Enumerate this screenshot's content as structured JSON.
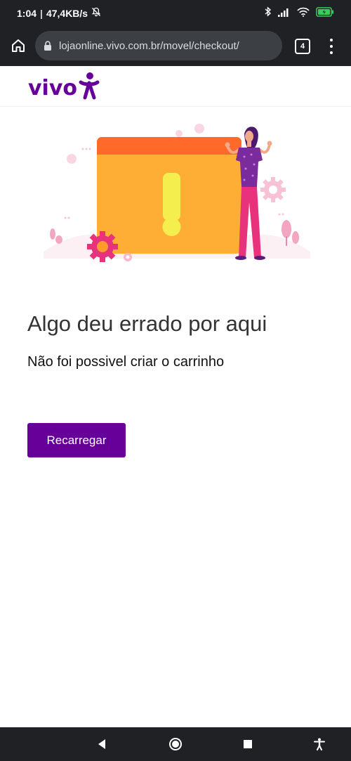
{
  "status_bar": {
    "time": "1:04",
    "separator": "|",
    "net_speed": "47,4KB/s",
    "icons": [
      "bell-off-icon",
      "bluetooth-icon",
      "signal-icon",
      "wifi-icon",
      "battery-charging-icon"
    ],
    "battery_color": "#34d058"
  },
  "browser": {
    "url": "lojaonline.vivo.com.br/movel/checkout/",
    "tab_count": "4",
    "icons": [
      "home-icon",
      "lock-icon",
      "tab-switcher-icon",
      "more-vert-icon"
    ]
  },
  "site": {
    "logo_text": "vivo",
    "brand_color": "#660099"
  },
  "illustration": {
    "icon": "error-window-illustration",
    "colors": {
      "window": "#ffae35",
      "window_bar": "#ff6a2a",
      "exclamation": "#f4ee4f",
      "gear_pink": "#e8327c",
      "gear_orange": "#ff9a2e"
    }
  },
  "error": {
    "title": "Algo deu errado por aqui",
    "message": "Não foi possivel criar o carrinho",
    "button_label": "Recarregar"
  },
  "nav_bar": {
    "icons": [
      "back-icon",
      "home-circle-icon",
      "recents-icon",
      "accessibility-icon"
    ]
  }
}
